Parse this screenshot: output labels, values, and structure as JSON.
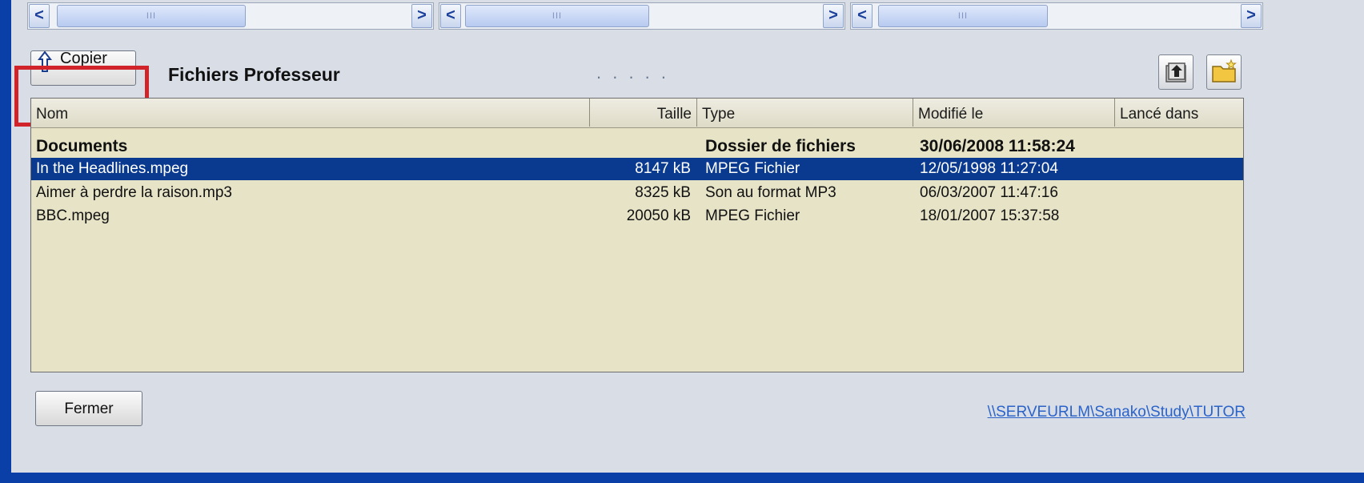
{
  "toolbar": {
    "copy_label": "Copier",
    "title": "Fichiers Professeur",
    "dots": ". . . . ."
  },
  "scrollbars": {
    "left_arrow": "<",
    "right_arrow": ">",
    "thumb_grip": "III"
  },
  "columns": {
    "name": "Nom",
    "size": "Taille",
    "type": "Type",
    "modified": "Modifié le",
    "launched": "Lancé dans"
  },
  "rows": [
    {
      "name": "Documents",
      "size": "",
      "type": "Dossier de fichiers",
      "modified": "30/06/2008 11:58:24",
      "bold": true,
      "selected": false
    },
    {
      "name": "In the Headlines.mpeg",
      "size": "8147 kB",
      "type": "MPEG Fichier",
      "modified": "12/05/1998 11:27:04",
      "bold": false,
      "selected": true
    },
    {
      "name": "Aimer à perdre la raison.mp3",
      "size": "8325 kB",
      "type": "Son au format MP3",
      "modified": "06/03/2007 11:47:16",
      "bold": false,
      "selected": false
    },
    {
      "name": "BBC.mpeg",
      "size": "20050 kB",
      "type": "MPEG Fichier",
      "modified": "18/01/2007 15:37:58",
      "bold": false,
      "selected": false
    }
  ],
  "footer": {
    "close_label": "Fermer",
    "path": "\\\\SERVEURLM\\Sanako\\Study\\TUTOR"
  },
  "colors": {
    "selection": "#0a3a8f",
    "list_background": "#e6e3c7",
    "highlight": "#d0232a",
    "window_frame": "#0b3fa8"
  },
  "icons": {
    "copy": "upload-arrow-icon",
    "up_folder": "folder-up-icon",
    "new_folder": "new-folder-icon"
  }
}
